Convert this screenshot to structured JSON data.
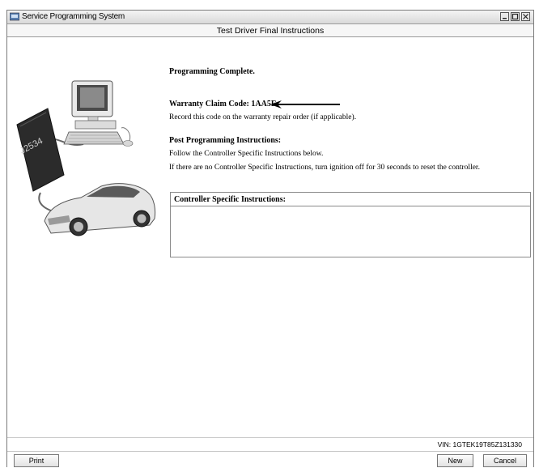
{
  "window": {
    "title": "Service Programming System"
  },
  "header": {
    "title": "Test Driver Final Instructions"
  },
  "illustration": {
    "device_label": "J2534"
  },
  "main": {
    "status_heading": "Programming Complete.",
    "warranty_label": "Warranty Claim Code: 1AA5F",
    "warranty_note": "Record this code on the warranty repair order (if applicable).",
    "post_heading": "Post Programming Instructions:",
    "post_line1": "Follow the Controller Specific Instructions below.",
    "post_line2": "If there are no Controller Specific Instructions, turn ignition off for 30 seconds to reset the controller.",
    "controller_box_title": "Controller Specific Instructions:"
  },
  "status": {
    "vin": "VIN: 1GTEK19T85Z131330"
  },
  "buttons": {
    "print": "Print",
    "new": "New",
    "cancel": "Cancel"
  },
  "colors": {
    "titlebar": "#d9d9d9",
    "border": "#8a8a8a",
    "car": "#e6e6e6",
    "device": "#2b2b2b"
  }
}
